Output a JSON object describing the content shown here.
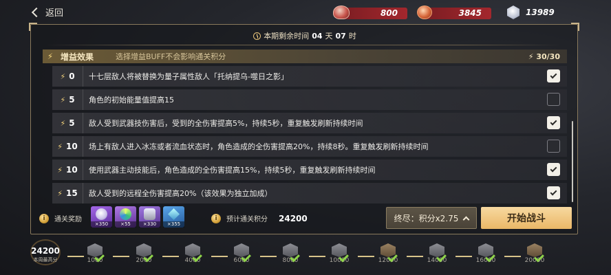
{
  "topbar": {
    "back_label": "返回",
    "currencies": [
      {
        "icon": "red-gem-icon",
        "value": "800"
      },
      {
        "icon": "orange-coin-icon",
        "value": "3845"
      }
    ],
    "points": {
      "icon": "crystal-icon",
      "value": "13989"
    }
  },
  "timer": {
    "label": "本期剩余时间",
    "days": "04",
    "days_unit": "天",
    "hours": "07",
    "hours_unit": "时"
  },
  "buff_section": {
    "title": "增益效果",
    "hint": "选择增益BUFF不会影响通关积分",
    "count": "30/30",
    "items": [
      {
        "cost": "0",
        "desc": "十七层敌人将被替换为量子属性敌人「托纳提乌-噬日之影」",
        "checked": true
      },
      {
        "cost": "5",
        "desc": "角色的初始能量值提高15",
        "checked": false
      },
      {
        "cost": "5",
        "desc": "敌人受到武器技伤害后，受到的全伤害提高5%，持续5秒，重复触发刷新持续时间",
        "checked": true
      },
      {
        "cost": "10",
        "desc": "场上有敌人进入冰冻或者流血状态时，角色造成的全伤害提高20%，持续8秒。重复触发刷新持续时间",
        "checked": false
      },
      {
        "cost": "10",
        "desc": "使用武器主动技能后，角色造成的全伤害提高15%，持续5秒，重复触发刷新持续时间",
        "checked": true
      },
      {
        "cost": "15",
        "desc": "敌人受到的远程全伤害提高20%（该效果为独立加成）",
        "checked": true
      }
    ]
  },
  "rewards": {
    "label": "通关奖励",
    "items": [
      {
        "icon": "purple-orb-icon",
        "qty": "×350"
      },
      {
        "icon": "rainbow-disc-icon",
        "qty": "×55"
      },
      {
        "icon": "robot-card-icon",
        "qty": "×330"
      },
      {
        "icon": "blue-crystal-icon",
        "qty": "×355"
      }
    ]
  },
  "estimate": {
    "label": "预计通关积分",
    "value": "24200"
  },
  "mode_button": "终尽：积分x2.75",
  "start_button": "开始战斗",
  "progress": {
    "score": "24200",
    "caption": "本周最高分",
    "nodes": [
      {
        "level": "1000",
        "style": "grey"
      },
      {
        "level": "2000",
        "style": "grey"
      },
      {
        "level": "4000",
        "style": "grey"
      },
      {
        "level": "6000",
        "style": "grey"
      },
      {
        "level": "8000",
        "style": "grey"
      },
      {
        "level": "10000",
        "style": "grey"
      },
      {
        "level": "12000",
        "style": "gold"
      },
      {
        "level": "14000",
        "style": "grey"
      },
      {
        "level": "16000",
        "style": "grey"
      },
      {
        "level": "20000",
        "style": "gold"
      }
    ]
  }
}
